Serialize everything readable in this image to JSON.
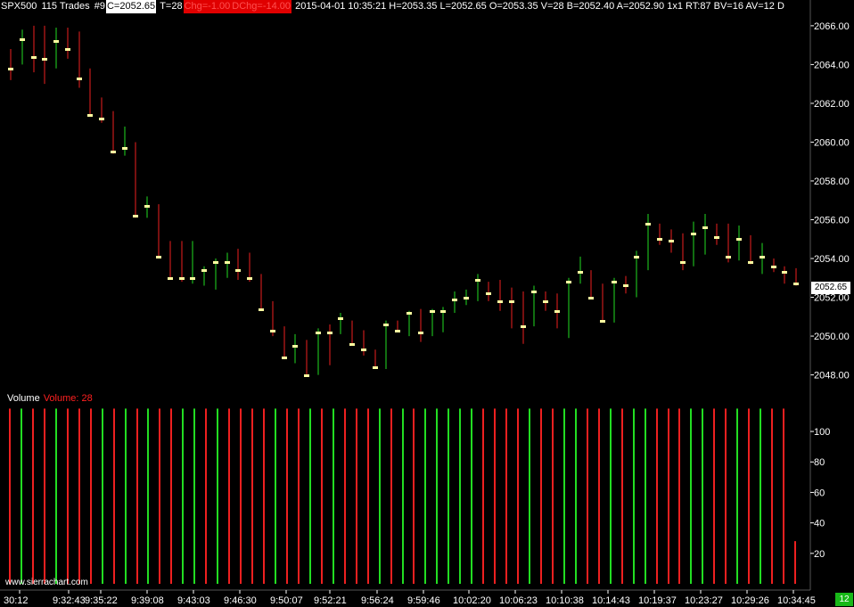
{
  "header": {
    "symbol": "SPX500",
    "trades": "115 Trades",
    "bar_number": "#9",
    "close": "C=2052.65",
    "ticks": "T=28",
    "change": "Chg=-1.00",
    "daily_change": "DChg=-14.00",
    "stats": "2015-04-01 10:35:21 H=2053.35 L=2052.65 O=2053.35 V=28 B=2052.40 A=2052.90 1x1 RT:87 BV=16 AV=12 D"
  },
  "volume_panel": {
    "title": "Volume",
    "value_label": "Volume: 28"
  },
  "watermark": "www.sierrachart.com",
  "bottom_badge": "12",
  "last_price_label": "2052.65",
  "colors": {
    "up": "#22dd22",
    "down": "#ee2020",
    "close_tick": "#ffffa0",
    "background": "#000000",
    "axis_text": "#ffffff"
  },
  "chart_data": [
    {
      "type": "ohlc",
      "title": "SPX500",
      "y_tick_labels": [
        "2048.00",
        "2050.00",
        "2052.00",
        "2054.00",
        "2056.00",
        "2058.00",
        "2060.00",
        "2062.00",
        "2064.00",
        "2066.00"
      ],
      "y_ticks": [
        2048,
        2050,
        2052,
        2054,
        2056,
        2058,
        2060,
        2062,
        2064,
        2066
      ],
      "ylim": [
        2047.2,
        2066.5
      ],
      "x_tick_labels": [
        "30:12",
        "9:32:43",
        "9:35:22",
        "9:39:08",
        "9:43:03",
        "9:46:30",
        "9:50:07",
        "9:52:21",
        "9:56:24",
        "9:59:46",
        "10:02:20",
        "10:06:23",
        "10:10:38",
        "10:14:43",
        "10:19:37",
        "10:23:27",
        "10:29:26",
        "10:34:45"
      ],
      "bars": [
        {
          "o": 2064.0,
          "h": 2064.8,
          "l": 2063.2,
          "c": 2063.8,
          "dir": "down"
        },
        {
          "o": 2064.6,
          "h": 2065.8,
          "l": 2064.0,
          "c": 2065.3,
          "dir": "up"
        },
        {
          "o": 2065.0,
          "h": 2066.0,
          "l": 2063.6,
          "c": 2064.4,
          "dir": "down"
        },
        {
          "o": 2064.5,
          "h": 2066.0,
          "l": 2063.0,
          "c": 2064.3,
          "dir": "down"
        },
        {
          "o": 2064.6,
          "h": 2065.9,
          "l": 2063.8,
          "c": 2065.2,
          "dir": "up"
        },
        {
          "o": 2065.0,
          "h": 2065.9,
          "l": 2064.3,
          "c": 2064.8,
          "dir": "down"
        },
        {
          "o": 2064.5,
          "h": 2065.7,
          "l": 2062.8,
          "c": 2063.3,
          "dir": "down"
        },
        {
          "o": 2063.5,
          "h": 2063.8,
          "l": 2061.3,
          "c": 2061.4,
          "dir": "down"
        },
        {
          "o": 2061.6,
          "h": 2062.3,
          "l": 2061.0,
          "c": 2061.2,
          "dir": "down"
        },
        {
          "o": 2061.4,
          "h": 2061.6,
          "l": 2059.4,
          "c": 2059.5,
          "dir": "down"
        },
        {
          "o": 2059.4,
          "h": 2060.8,
          "l": 2059.3,
          "c": 2059.7,
          "dir": "up"
        },
        {
          "o": 2059.9,
          "h": 2060.0,
          "l": 2056.1,
          "c": 2056.2,
          "dir": "down"
        },
        {
          "o": 2056.3,
          "h": 2057.2,
          "l": 2056.1,
          "c": 2056.7,
          "dir": "up"
        },
        {
          "o": 2056.8,
          "h": 2056.8,
          "l": 2054.0,
          "c": 2054.1,
          "dir": "down"
        },
        {
          "o": 2054.1,
          "h": 2054.9,
          "l": 2052.9,
          "c": 2053.0,
          "dir": "down"
        },
        {
          "o": 2053.3,
          "h": 2054.9,
          "l": 2052.8,
          "c": 2053.0,
          "dir": "down"
        },
        {
          "o": 2053.1,
          "h": 2054.9,
          "l": 2052.7,
          "c": 2053.0,
          "dir": "up"
        },
        {
          "o": 2053.3,
          "h": 2053.6,
          "l": 2052.6,
          "c": 2053.4,
          "dir": "up"
        },
        {
          "o": 2053.3,
          "h": 2054.0,
          "l": 2052.4,
          "c": 2053.8,
          "dir": "up"
        },
        {
          "o": 2053.6,
          "h": 2054.3,
          "l": 2053.0,
          "c": 2053.8,
          "dir": "up"
        },
        {
          "o": 2053.7,
          "h": 2054.5,
          "l": 2052.9,
          "c": 2053.4,
          "dir": "down"
        },
        {
          "o": 2053.3,
          "h": 2054.3,
          "l": 2052.8,
          "c": 2053.0,
          "dir": "down"
        },
        {
          "o": 2053.1,
          "h": 2053.2,
          "l": 2051.3,
          "c": 2051.4,
          "dir": "down"
        },
        {
          "o": 2051.3,
          "h": 2051.8,
          "l": 2050.0,
          "c": 2050.3,
          "dir": "down"
        },
        {
          "o": 2050.3,
          "h": 2050.5,
          "l": 2048.8,
          "c": 2048.9,
          "dir": "down"
        },
        {
          "o": 2049.0,
          "h": 2050.1,
          "l": 2048.6,
          "c": 2049.5,
          "dir": "up"
        },
        {
          "o": 2049.8,
          "h": 2049.8,
          "l": 2047.9,
          "c": 2048.0,
          "dir": "down"
        },
        {
          "o": 2048.2,
          "h": 2050.4,
          "l": 2048.0,
          "c": 2050.2,
          "dir": "up"
        },
        {
          "o": 2050.2,
          "h": 2050.6,
          "l": 2048.5,
          "c": 2050.2,
          "dir": "down"
        },
        {
          "o": 2050.4,
          "h": 2051.2,
          "l": 2050.1,
          "c": 2050.9,
          "dir": "up"
        },
        {
          "o": 2050.7,
          "h": 2050.8,
          "l": 2049.5,
          "c": 2049.6,
          "dir": "down"
        },
        {
          "o": 2049.5,
          "h": 2050.3,
          "l": 2049.0,
          "c": 2049.3,
          "dir": "down"
        },
        {
          "o": 2049.1,
          "h": 2049.3,
          "l": 2048.3,
          "c": 2048.4,
          "dir": "down"
        },
        {
          "o": 2048.4,
          "h": 2050.8,
          "l": 2048.3,
          "c": 2050.6,
          "dir": "up"
        },
        {
          "o": 2050.5,
          "h": 2050.8,
          "l": 2050.2,
          "c": 2050.3,
          "dir": "down"
        },
        {
          "o": 2050.4,
          "h": 2051.3,
          "l": 2050.0,
          "c": 2051.2,
          "dir": "up"
        },
        {
          "o": 2051.2,
          "h": 2051.4,
          "l": 2049.7,
          "c": 2050.2,
          "dir": "down"
        },
        {
          "o": 2050.3,
          "h": 2051.4,
          "l": 2050.0,
          "c": 2051.3,
          "dir": "up"
        },
        {
          "o": 2051.2,
          "h": 2051.5,
          "l": 2050.2,
          "c": 2051.3,
          "dir": "up"
        },
        {
          "o": 2051.3,
          "h": 2052.3,
          "l": 2051.2,
          "c": 2051.9,
          "dir": "up"
        },
        {
          "o": 2051.9,
          "h": 2052.4,
          "l": 2051.6,
          "c": 2052.0,
          "dir": "up"
        },
        {
          "o": 2052.2,
          "h": 2053.2,
          "l": 2051.8,
          "c": 2052.9,
          "dir": "up"
        },
        {
          "o": 2052.7,
          "h": 2052.8,
          "l": 2051.8,
          "c": 2052.2,
          "dir": "down"
        },
        {
          "o": 2052.2,
          "h": 2052.9,
          "l": 2051.3,
          "c": 2051.8,
          "dir": "down"
        },
        {
          "o": 2051.8,
          "h": 2052.5,
          "l": 2050.4,
          "c": 2051.8,
          "dir": "down"
        },
        {
          "o": 2051.8,
          "h": 2052.3,
          "l": 2049.6,
          "c": 2050.5,
          "dir": "down"
        },
        {
          "o": 2050.6,
          "h": 2052.6,
          "l": 2050.5,
          "c": 2052.3,
          "dir": "up"
        },
        {
          "o": 2052.1,
          "h": 2052.3,
          "l": 2051.3,
          "c": 2051.8,
          "dir": "down"
        },
        {
          "o": 2051.8,
          "h": 2052.2,
          "l": 2050.4,
          "c": 2051.3,
          "dir": "down"
        },
        {
          "o": 2051.3,
          "h": 2053.0,
          "l": 2049.9,
          "c": 2052.8,
          "dir": "up"
        },
        {
          "o": 2052.9,
          "h": 2054.1,
          "l": 2052.7,
          "c": 2053.3,
          "dir": "up"
        },
        {
          "o": 2053.4,
          "h": 2053.4,
          "l": 2051.9,
          "c": 2052.0,
          "dir": "down"
        },
        {
          "o": 2052.0,
          "h": 2052.7,
          "l": 2050.7,
          "c": 2050.8,
          "dir": "down"
        },
        {
          "o": 2050.9,
          "h": 2053.0,
          "l": 2050.7,
          "c": 2052.8,
          "dir": "up"
        },
        {
          "o": 2052.7,
          "h": 2053.1,
          "l": 2052.2,
          "c": 2052.6,
          "dir": "down"
        },
        {
          "o": 2052.6,
          "h": 2054.4,
          "l": 2052.0,
          "c": 2054.1,
          "dir": "up"
        },
        {
          "o": 2054.0,
          "h": 2056.3,
          "l": 2053.4,
          "c": 2055.8,
          "dir": "up"
        },
        {
          "o": 2055.6,
          "h": 2055.8,
          "l": 2054.7,
          "c": 2055.0,
          "dir": "down"
        },
        {
          "o": 2055.0,
          "h": 2055.5,
          "l": 2054.3,
          "c": 2054.9,
          "dir": "down"
        },
        {
          "o": 2054.8,
          "h": 2055.3,
          "l": 2053.4,
          "c": 2053.8,
          "dir": "down"
        },
        {
          "o": 2053.9,
          "h": 2055.9,
          "l": 2053.6,
          "c": 2055.3,
          "dir": "up"
        },
        {
          "o": 2055.4,
          "h": 2056.3,
          "l": 2054.2,
          "c": 2055.6,
          "dir": "up"
        },
        {
          "o": 2055.6,
          "h": 2055.8,
          "l": 2054.7,
          "c": 2055.1,
          "dir": "down"
        },
        {
          "o": 2055.2,
          "h": 2055.8,
          "l": 2053.8,
          "c": 2054.1,
          "dir": "down"
        },
        {
          "o": 2054.4,
          "h": 2055.7,
          "l": 2053.9,
          "c": 2055.0,
          "dir": "up"
        },
        {
          "o": 2055.0,
          "h": 2055.2,
          "l": 2053.7,
          "c": 2053.8,
          "dir": "down"
        },
        {
          "o": 2053.9,
          "h": 2054.8,
          "l": 2053.2,
          "c": 2054.1,
          "dir": "up"
        },
        {
          "o": 2054.0,
          "h": 2054.0,
          "l": 2053.3,
          "c": 2053.6,
          "dir": "down"
        },
        {
          "o": 2053.5,
          "h": 2053.6,
          "l": 2052.7,
          "c": 2053.3,
          "dir": "down"
        },
        {
          "o": 2053.3,
          "h": 2053.5,
          "l": 2052.6,
          "c": 2052.7,
          "dir": "down"
        }
      ]
    },
    {
      "type": "bar",
      "title": "Volume",
      "y_tick_labels": [
        "20",
        "40",
        "60",
        "80",
        "100"
      ],
      "y_ticks": [
        20,
        40,
        60,
        80,
        100
      ],
      "ylim": [
        0,
        117
      ],
      "values_note": "",
      "values": [
        115,
        115,
        115,
        115,
        115,
        115,
        115,
        115,
        115,
        115,
        115,
        115,
        115,
        115,
        115,
        115,
        115,
        115,
        115,
        115,
        115,
        115,
        115,
        115,
        115,
        115,
        115,
        115,
        115,
        115,
        115,
        115,
        115,
        115,
        115,
        115,
        115,
        115,
        115,
        115,
        115,
        115,
        115,
        115,
        115,
        115,
        115,
        115,
        115,
        115,
        115,
        115,
        115,
        115,
        115,
        115,
        115,
        115,
        115,
        115,
        115,
        115,
        115,
        115,
        115,
        115,
        115,
        115,
        28
      ],
      "colors": [
        "down",
        "up",
        "down",
        "down",
        "up",
        "down",
        "down",
        "down",
        "up",
        "down",
        "up",
        "down",
        "up",
        "down",
        "down",
        "up",
        "up",
        "down",
        "up",
        "down",
        "down",
        "down",
        "down",
        "up",
        "down",
        "down",
        "up",
        "down",
        "up",
        "down",
        "down",
        "down",
        "up",
        "down",
        "up",
        "down",
        "up",
        "up",
        "up",
        "up",
        "up",
        "down",
        "down",
        "down",
        "down",
        "up",
        "down",
        "down",
        "up",
        "up",
        "down",
        "down",
        "up",
        "down",
        "up",
        "up",
        "down",
        "down",
        "down",
        "up",
        "up",
        "down",
        "down",
        "up",
        "down",
        "up",
        "down",
        "down",
        "down"
      ]
    }
  ]
}
